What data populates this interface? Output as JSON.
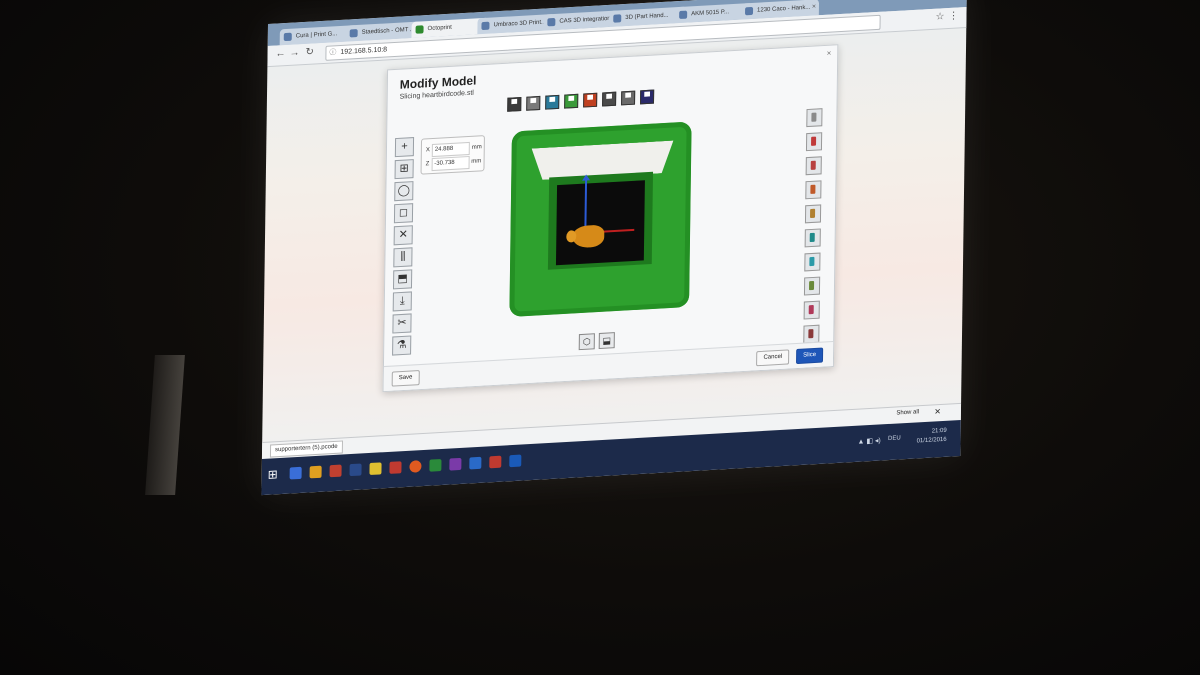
{
  "browser": {
    "tabs": [
      {
        "label": "Cura | Print G..."
      },
      {
        "label": "Staedtisch - OMT ..."
      },
      {
        "label": "Octoprint",
        "active": true
      },
      {
        "label": "Umbraco 3D Print..."
      },
      {
        "label": "CAS 3D integration ..."
      },
      {
        "label": "3D (Part Hand..."
      },
      {
        "label": "AKM 5015 P..."
      },
      {
        "label": "1230 Caco - Hank..."
      }
    ],
    "url": "192.168.5.10:8",
    "window_controls": "– ❐ ✕"
  },
  "modal": {
    "title": "Modify Model",
    "subtitle": "Slicing heartbirdcode.stl",
    "close": "×",
    "materials": [
      {
        "symbol": "▀",
        "color": "#3b3b3b"
      },
      {
        "symbol": "▀",
        "color": "#7a7a7a"
      },
      {
        "symbol": "▀",
        "color": "#2a7a9a"
      },
      {
        "symbol": "▀",
        "color": "#3a9a3a"
      },
      {
        "symbol": "▀",
        "color": "#c04020"
      },
      {
        "symbol": "▀",
        "color": "#4a4a4a"
      },
      {
        "symbol": "▀",
        "color": "#6a6a6a"
      },
      {
        "symbol": "▀",
        "color": "#2a2a6a"
      }
    ],
    "coords": {
      "x_label": "X",
      "x_value": "24.888",
      "z_label": "Z",
      "z_value": "-30.738",
      "unit": "mm"
    },
    "left_tools": [
      "+",
      "⊞",
      "◯",
      "◻",
      "✕",
      "⫼",
      "⬒",
      "⤓",
      "✂",
      "⚗"
    ],
    "right_tool_colors": [
      "#8a8a8a",
      "#c03a3a",
      "#b84040",
      "#c05a2a",
      "#b08030",
      "#1f8a8a",
      "#2a9aa8",
      "#6a8a3a",
      "#b03a5a",
      "#8a3a3a"
    ],
    "view_buttons": [
      "⬡",
      "⬓"
    ],
    "footer": {
      "save": "Save",
      "cancel": "Cancel",
      "slice": "Slice"
    }
  },
  "downloads": {
    "item": "supportertern (5).pcode",
    "show_all": "Show all",
    "close": "✕"
  },
  "taskbar": {
    "start": "⊞",
    "icons": [
      "#3a6ed8",
      "#e0a020",
      "#c04030",
      "#2a4a8a",
      "#e0c030",
      "#c03a30",
      "#e05a20",
      "#2a8a3a",
      "#7a3aa8",
      "#2a6ac8",
      "#c03a30",
      "#1a5ab8"
    ],
    "tray_icons": "▲ ◧ ◂)",
    "lang": "DEU",
    "time": "21:09",
    "date": "01/12/2016"
  }
}
